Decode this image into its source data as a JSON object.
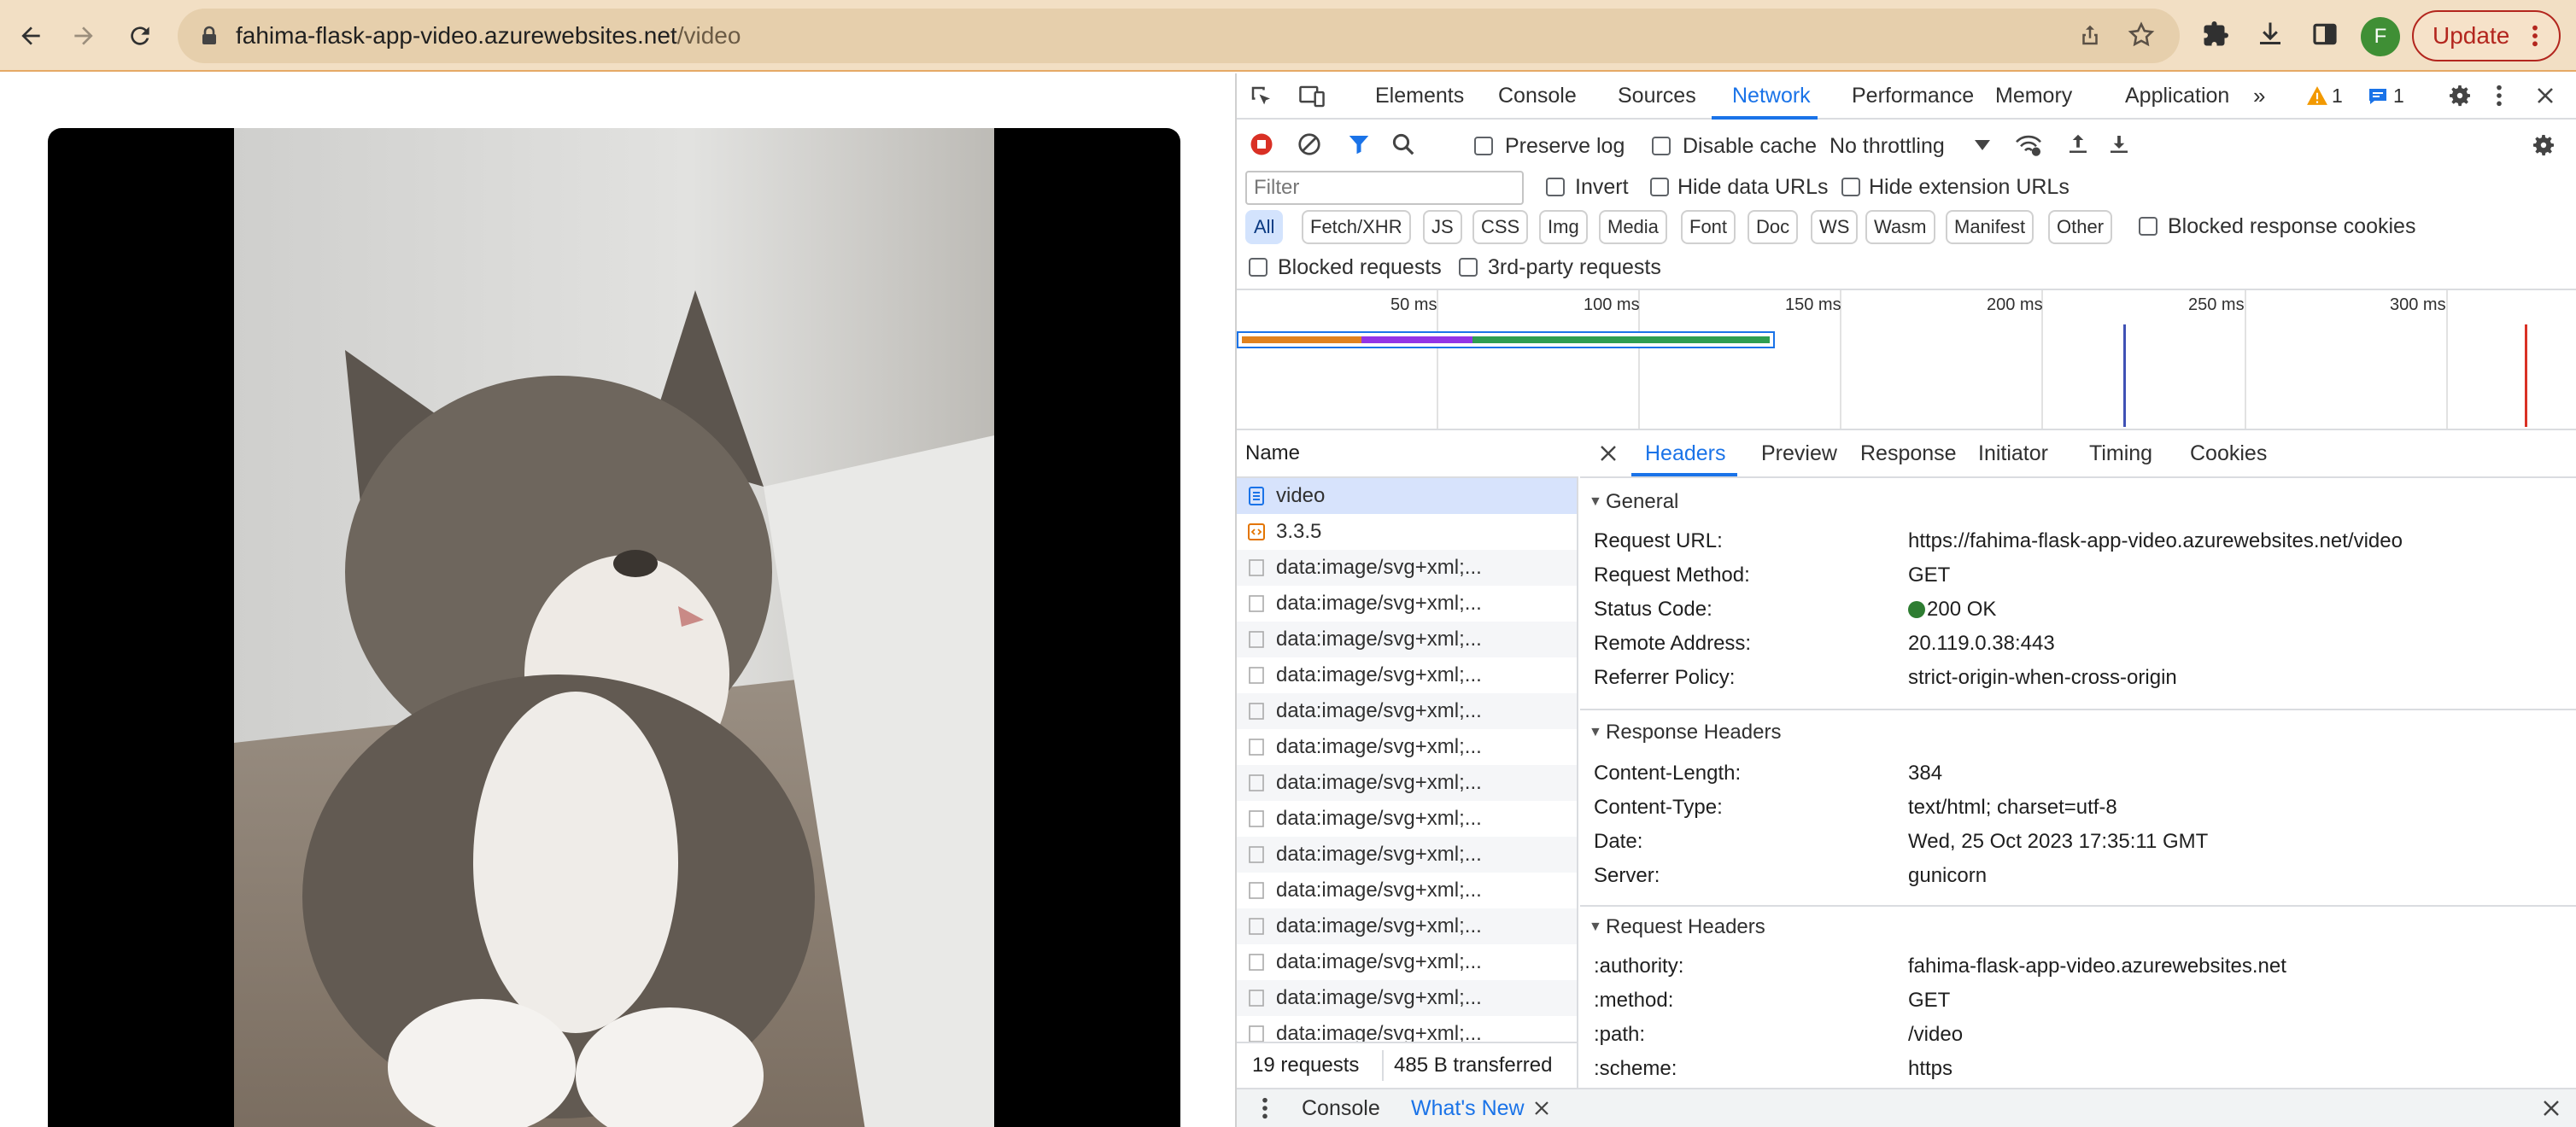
{
  "browser": {
    "url_host": "fahima-flask-app-video.azurewebsites.net",
    "url_path": "/video",
    "profile_initial": "F",
    "update_label": "Update"
  },
  "devtools": {
    "tabs": [
      "Elements",
      "Console",
      "Sources",
      "Network",
      "Performance",
      "Memory",
      "Application"
    ],
    "active_tab": "Network",
    "warning_count": "1",
    "message_count": "1",
    "network": {
      "preserve_log": "Preserve log",
      "disable_cache": "Disable cache",
      "throttling": "No throttling",
      "filter_placeholder": "Filter",
      "invert": "Invert",
      "hide_data_urls": "Hide data URLs",
      "hide_extension_urls": "Hide extension URLs",
      "type_filters": [
        "All",
        "Fetch/XHR",
        "JS",
        "CSS",
        "Img",
        "Media",
        "Font",
        "Doc",
        "WS",
        "Wasm",
        "Manifest",
        "Other"
      ],
      "blocked_response_cookies": "Blocked response cookies",
      "blocked_requests": "Blocked requests",
      "third_party_requests": "3rd-party requests",
      "timeline_ticks": [
        "50 ms",
        "100 ms",
        "150 ms",
        "200 ms",
        "250 ms",
        "300 ms"
      ],
      "name_header": "Name",
      "requests": [
        "video",
        "3.3.5",
        "data:image/svg+xml;...",
        "data:image/svg+xml;...",
        "data:image/svg+xml;...",
        "data:image/svg+xml;...",
        "data:image/svg+xml;...",
        "data:image/svg+xml;...",
        "data:image/svg+xml;...",
        "data:image/svg+xml;...",
        "data:image/svg+xml;...",
        "data:image/svg+xml;...",
        "data:image/svg+xml;...",
        "data:image/svg+xml;...",
        "data:image/svg+xml;...",
        "data:image/svg+xml;..."
      ],
      "summary_requests": "19 requests",
      "summary_transferred": "485 B transferred"
    },
    "details": {
      "tabs": [
        "Headers",
        "Preview",
        "Response",
        "Initiator",
        "Timing",
        "Cookies"
      ],
      "active_tab": "Headers",
      "general_title": "General",
      "general": [
        {
          "key": "Request URL:",
          "value": "https://fahima-flask-app-video.azurewebsites.net/video"
        },
        {
          "key": "Request Method:",
          "value": "GET"
        },
        {
          "key": "Status Code:",
          "value": "200 OK"
        },
        {
          "key": "Remote Address:",
          "value": "20.119.0.38:443"
        },
        {
          "key": "Referrer Policy:",
          "value": "strict-origin-when-cross-origin"
        }
      ],
      "response_title": "Response Headers",
      "response": [
        {
          "key": "Content-Length:",
          "value": "384"
        },
        {
          "key": "Content-Type:",
          "value": "text/html; charset=utf-8"
        },
        {
          "key": "Date:",
          "value": "Wed, 25 Oct 2023 17:35:11 GMT"
        },
        {
          "key": "Server:",
          "value": "gunicorn"
        }
      ],
      "request_title": "Request Headers",
      "request": [
        {
          "key": ":authority:",
          "value": "fahima-flask-app-video.azurewebsites.net"
        },
        {
          "key": ":method:",
          "value": "GET"
        },
        {
          "key": ":path:",
          "value": "/video"
        },
        {
          "key": ":scheme:",
          "value": "https"
        }
      ]
    },
    "drawer": {
      "console": "Console",
      "whats_new": "What's New"
    }
  },
  "colors": {
    "toolbar_bg": "#f2dfc4",
    "accent": "#1a73e8",
    "status_ok": "#2e7d32",
    "update": "#b3261e"
  }
}
